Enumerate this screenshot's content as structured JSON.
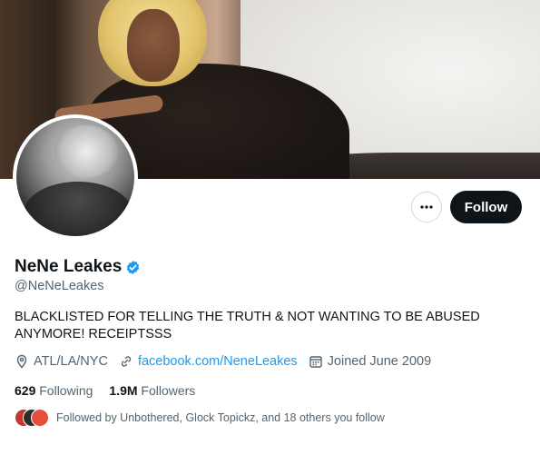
{
  "profile": {
    "name": "NeNe Leakes",
    "handle": "@NeNeLeakes",
    "bio": "BLACKLISTED FOR TELLING THE TRUTH & NOT WANTING TO BE ABUSED ANYMORE! RECEIPTSSS",
    "location": "ATL/LA/NYC",
    "website": "facebook.com/NeneLeakes",
    "joined": "Joined June 2009"
  },
  "stats": {
    "following_count": "629",
    "following_label": "Following",
    "followers_count": "1.9M",
    "followers_label": "Followers"
  },
  "actions": {
    "follow_label": "Follow",
    "more_icon": "more-icon"
  },
  "followed_by": {
    "text": "Followed by Unbothered, Glock Topickz, and 18 others you follow"
  },
  "colors": {
    "accent": "#1d9bf0",
    "follow_button": "#0f1419",
    "secondary_text": "#536471"
  },
  "icons": {
    "verified": "verified-badge-icon",
    "location": "location-pin-icon",
    "link": "link-icon",
    "calendar": "calendar-icon"
  }
}
